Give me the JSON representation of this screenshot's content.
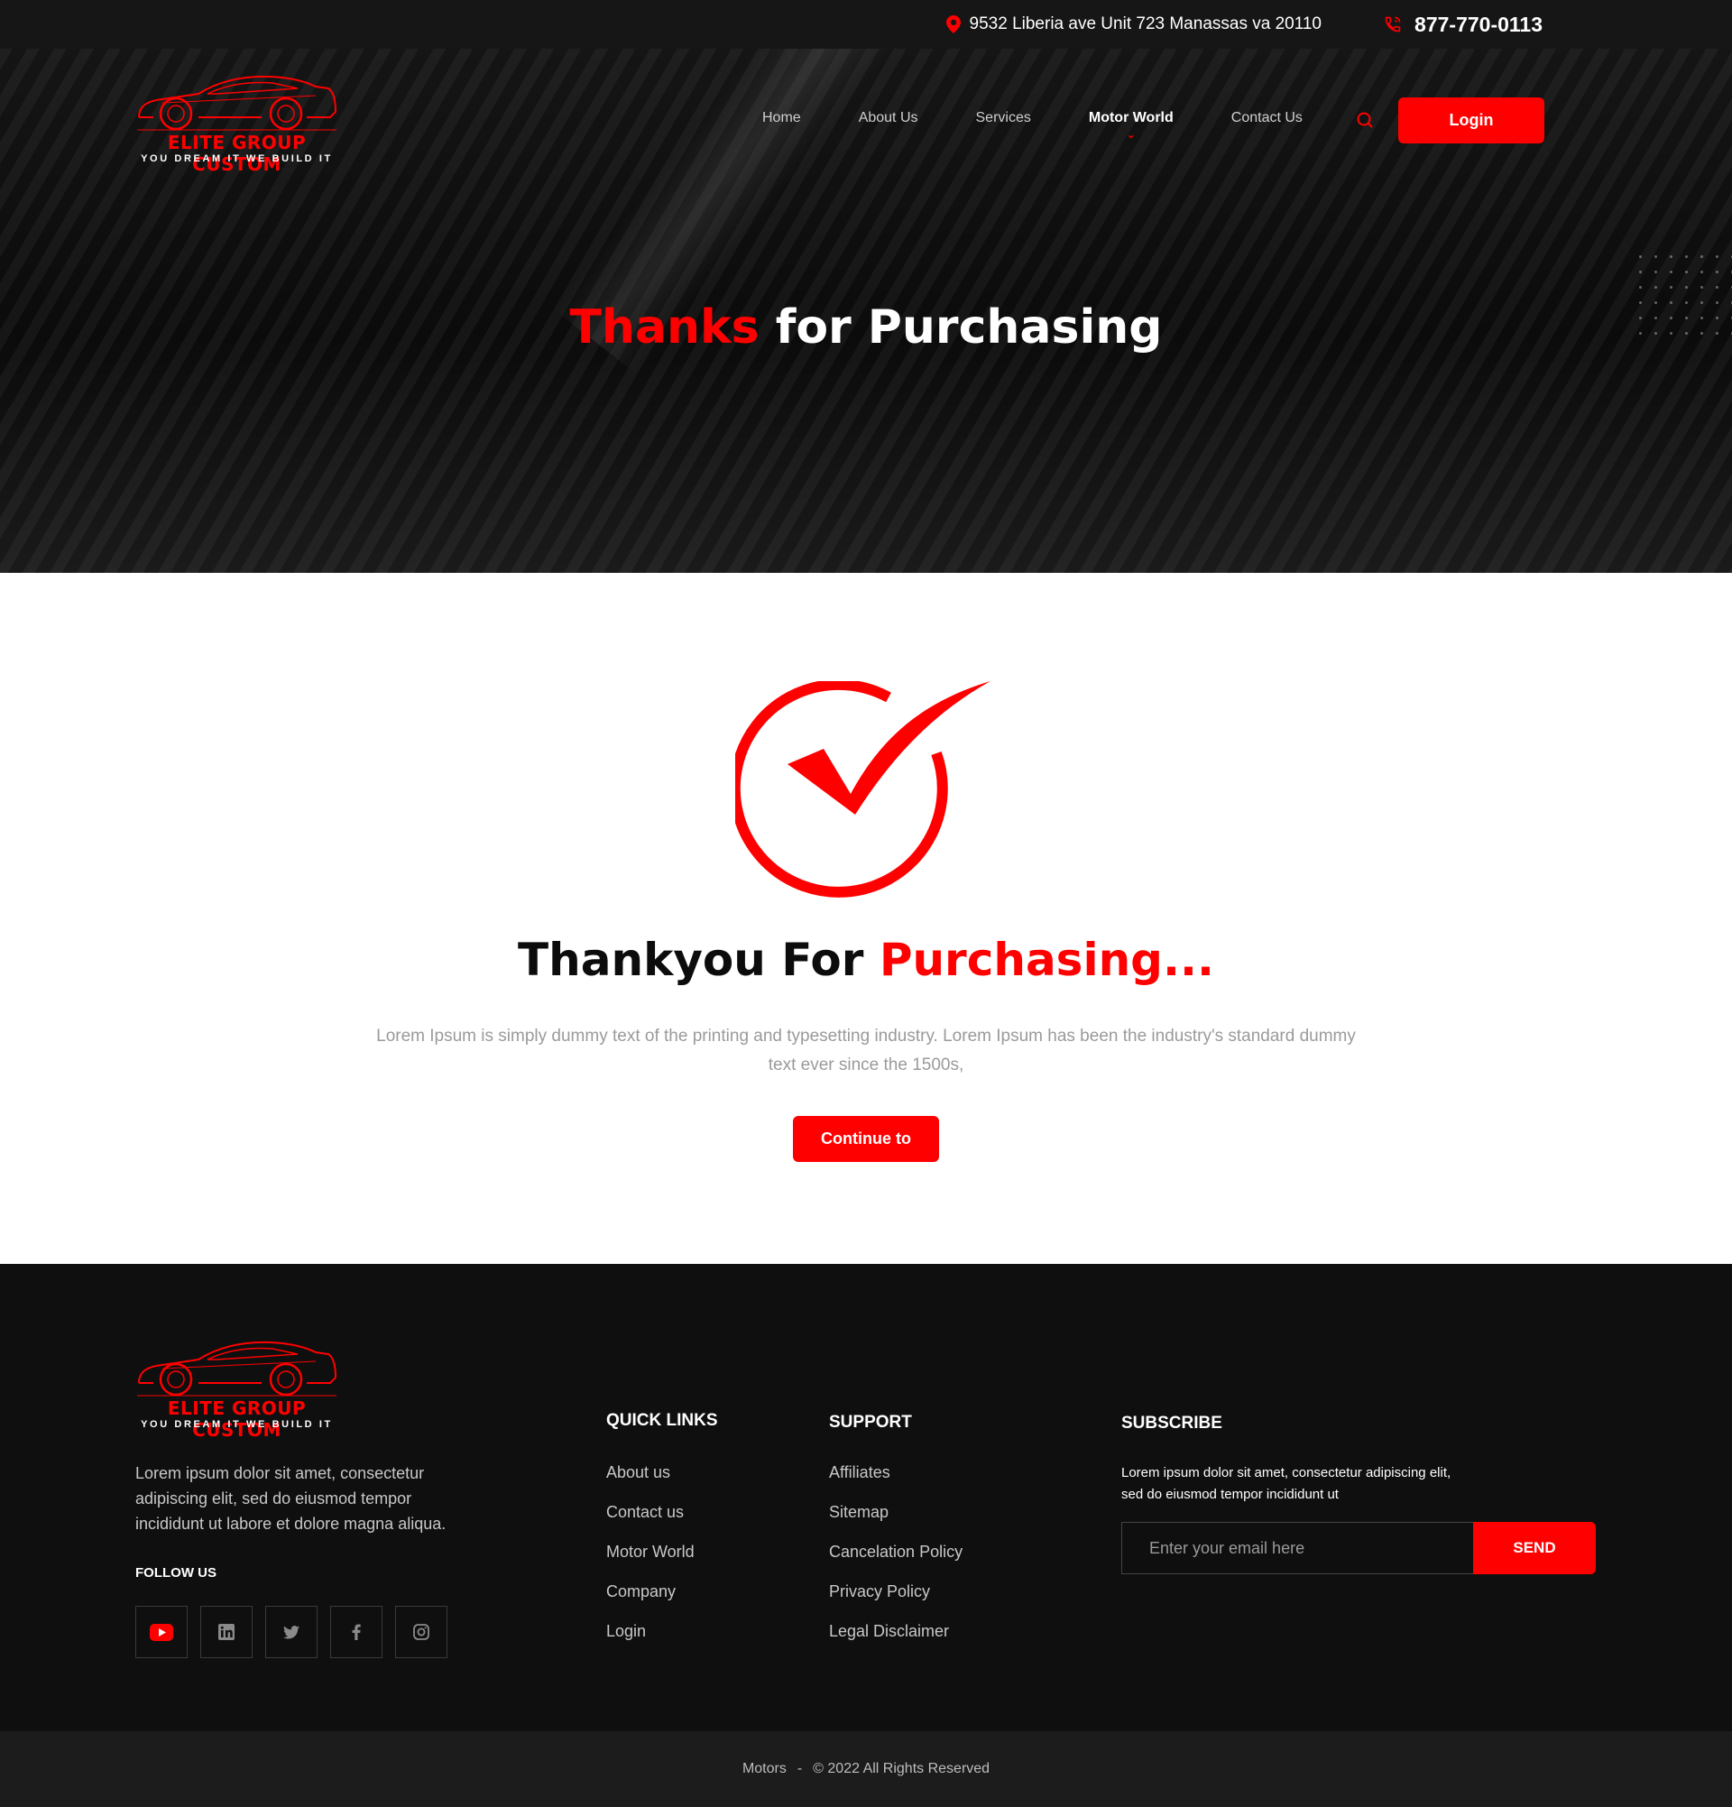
{
  "topbar": {
    "address": "9532 Liberia ave Unit 723 Manassas va 20110",
    "phone": "877-770-0113",
    "icons": [
      "map-pin-icon",
      "phone-icon"
    ]
  },
  "brand": {
    "name": "ELITE GROUP CUSTOM",
    "tagline": "YOU DREAM IT WE BUILD IT"
  },
  "nav": {
    "items": [
      {
        "label": "Home"
      },
      {
        "label": "About Us"
      },
      {
        "label": "Services"
      },
      {
        "label": "Motor World",
        "active": true
      },
      {
        "label": "Contact Us"
      }
    ],
    "login_label": "Login"
  },
  "hero": {
    "title_accent": "Thanks",
    "title_rest": " for Purchasing"
  },
  "main": {
    "title_plain": "Thankyou For ",
    "title_accent": "Purchasing...",
    "description": "Lorem Ipsum is simply dummy text of the printing and typesetting industry. Lorem Ipsum has been the industry's standard dummy text ever since the 1500s,",
    "button_label": "Continue to"
  },
  "footer": {
    "about": "Lorem ipsum dolor sit amet, consectetur adipiscing elit, sed do eiusmod tempor incididunt ut labore et dolore magna aliqua.",
    "follow_label": "FOLLOW US",
    "socials": [
      "youtube-icon",
      "linkedin-icon",
      "twitter-icon",
      "facebook-icon",
      "instagram-icon"
    ],
    "quick_links": {
      "title": "QUICK LINKS",
      "items": [
        "About us",
        "Contact us",
        "Motor World",
        "Company",
        "Login"
      ]
    },
    "support": {
      "title": "SUPPORT",
      "items": [
        "Affiliates",
        "Sitemap",
        "Cancelation Policy",
        "Privacy Policy",
        "Legal Disclaimer"
      ]
    },
    "subscribe": {
      "title": "SUBSCRIBE",
      "text": "Lorem ipsum dolor sit amet, consectetur adipiscing elit, sed do eiusmod tempor incididunt ut",
      "placeholder": "Enter your email here",
      "button_label": "SEND"
    }
  },
  "copyright": {
    "site": "Motors",
    "separator": "-",
    "text": "© 2022 All Rights Reserved"
  },
  "colors": {
    "accent": "#ff0000",
    "dark": "#0f0f0f",
    "topbar": "#161616",
    "muted_text": "#9a9a9a"
  }
}
